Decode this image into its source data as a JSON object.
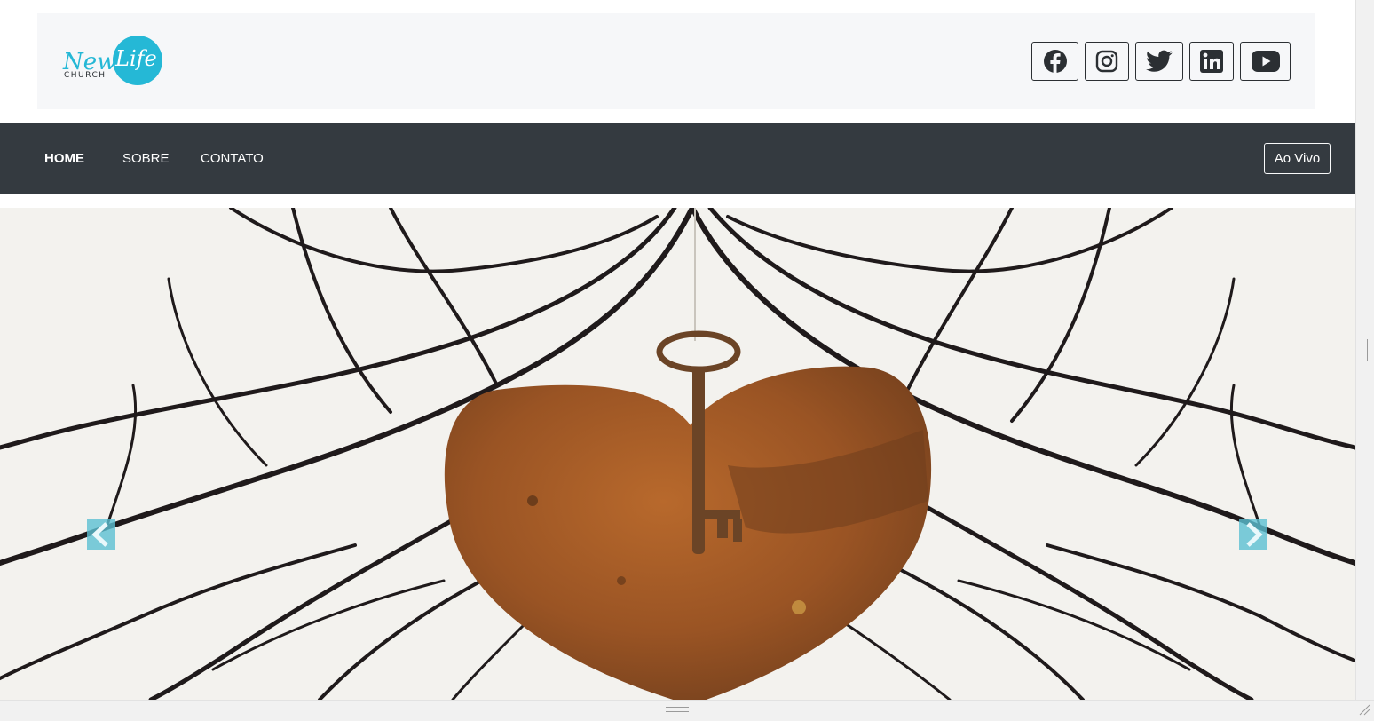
{
  "header": {
    "logo": {
      "word_new": "New",
      "word_life": "Life",
      "word_church": "CHURCH",
      "accent_color": "#25b8d6"
    },
    "social": [
      {
        "name": "facebook",
        "icon": "facebook-icon"
      },
      {
        "name": "instagram",
        "icon": "instagram-icon"
      },
      {
        "name": "twitter",
        "icon": "twitter-icon"
      },
      {
        "name": "linkedin",
        "icon": "linkedin-icon"
      },
      {
        "name": "youtube",
        "icon": "youtube-icon"
      }
    ]
  },
  "nav": {
    "items": [
      {
        "label": "HOME",
        "active": true
      },
      {
        "label": "SOBRE",
        "active": false
      },
      {
        "label": "CONTATO",
        "active": false
      }
    ],
    "live_button": "Ao Vivo",
    "background": "#343a40"
  },
  "carousel": {
    "image": "rusty heart with key hanging on branches",
    "prev_icon": "chevron-left-icon",
    "next_icon": "chevron-right-icon",
    "arrow_color": "#5bbfd2"
  }
}
